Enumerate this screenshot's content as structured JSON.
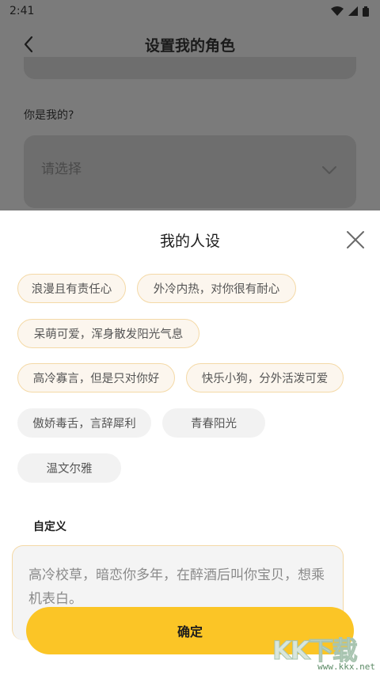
{
  "status_bar": {
    "time": "2:41"
  },
  "header": {
    "title": "设置我的角色"
  },
  "form": {
    "who_label": "你是我的?",
    "select_placeholder": "请选择"
  },
  "sheet": {
    "title": "我的人设",
    "tags": [
      {
        "label": "浪漫且有责任心",
        "selected": true
      },
      {
        "label": "外冷内热，对你很有耐心",
        "selected": true
      },
      {
        "label": "呆萌可爱，浑身散发阳光气息",
        "selected": true
      },
      {
        "label": "高冷寡言，但是只对你好",
        "selected": true
      },
      {
        "label": "快乐小狗，分外活泼可爱",
        "selected": true
      },
      {
        "label": "傲娇毒舌，言辞犀利",
        "selected": false
      },
      {
        "label": "青春阳光",
        "selected": false
      },
      {
        "label": "温文尔雅",
        "selected": false
      }
    ],
    "custom_label": "自定义",
    "custom_text": "高冷校草，暗恋你多年，在醉酒后叫你宝贝，想乘机表白。",
    "confirm_label": "确定"
  },
  "watermark": {
    "big": "KK下载",
    "small": "www.kkx.net"
  },
  "colors": {
    "accent": "#fbc526",
    "tag_border": "#f4d9a6",
    "tag_bg": "#fcf6ee",
    "overlay": "#7b7b7b"
  }
}
